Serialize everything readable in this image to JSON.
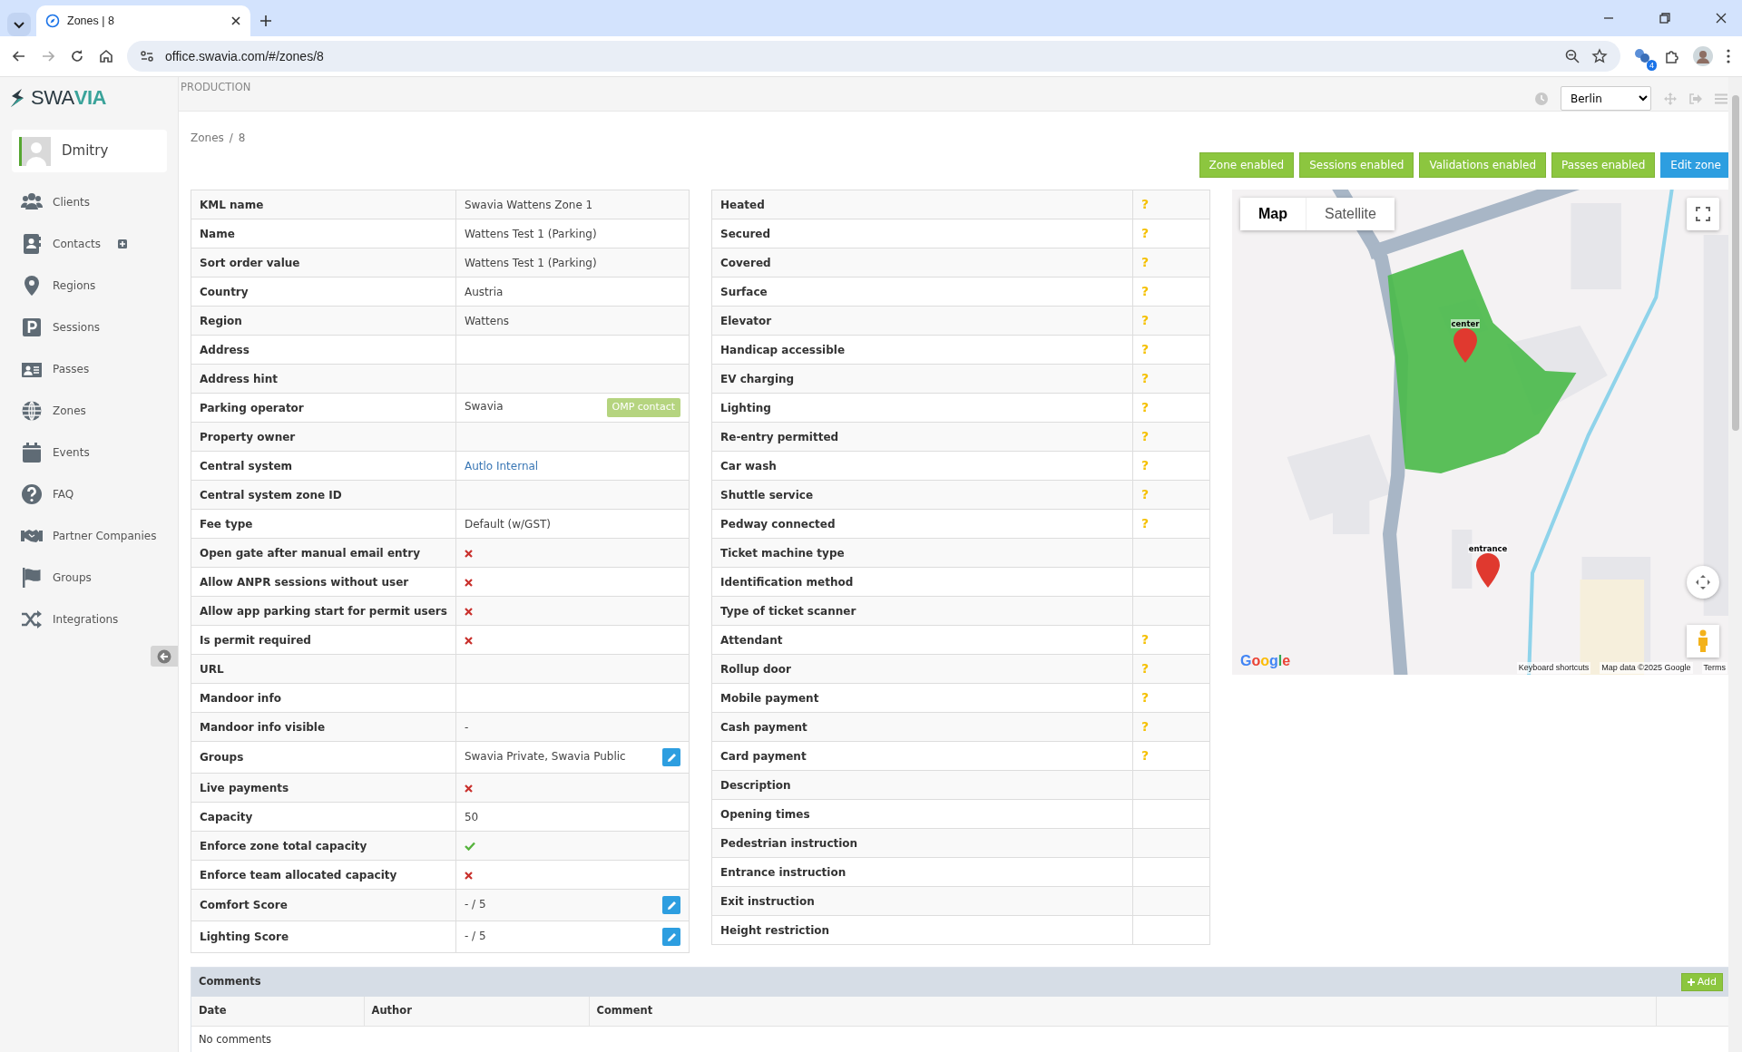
{
  "browser": {
    "tabs": [
      {
        "title": "Zones | 8",
        "selected": true
      }
    ],
    "url": "office.swavia.com/#/zones/8",
    "extension_badge": "4"
  },
  "app": {
    "logo": {
      "prefix": "SWA",
      "suffix": "VIA"
    },
    "environment": "PRODUCTION",
    "timezone": "Berlin"
  },
  "sidebar": {
    "user": "Dmitry",
    "items": [
      {
        "label": "Clients",
        "kind": "plain"
      },
      {
        "label": "Contacts",
        "kind": "with_add"
      },
      {
        "label": "Regions",
        "kind": "plain"
      },
      {
        "label": "Sessions",
        "kind": "plain"
      },
      {
        "label": "Passes",
        "kind": "plain"
      },
      {
        "label": "Zones",
        "kind": "plain"
      },
      {
        "label": "Events",
        "kind": "plain"
      },
      {
        "label": "FAQ",
        "kind": "plain"
      },
      {
        "label": "Partner Companies",
        "kind": "plain"
      },
      {
        "label": "Groups",
        "kind": "plain"
      },
      {
        "label": "Integrations",
        "kind": "plain"
      }
    ]
  },
  "breadcrumb": {
    "items": [
      "Zones",
      "8"
    ],
    "separator": "/"
  },
  "actions": [
    {
      "label": "Zone enabled",
      "kind": "status"
    },
    {
      "label": "Sessions enabled",
      "kind": "status"
    },
    {
      "label": "Validations enabled",
      "kind": "status"
    },
    {
      "label": "Passes enabled",
      "kind": "status"
    },
    {
      "label": "Edit zone",
      "kind": "edit"
    }
  ],
  "details": [
    {
      "label": "KML name",
      "kind": "text",
      "value": "Swavia Wattens Zone 1"
    },
    {
      "label": "Name",
      "kind": "text",
      "value": "Wattens Test 1 (Parking)"
    },
    {
      "label": "Sort order value",
      "kind": "text",
      "value": "Wattens Test 1 (Parking)"
    },
    {
      "label": "Country",
      "kind": "text",
      "value": "Austria"
    },
    {
      "label": "Region",
      "kind": "text",
      "value": "Wattens"
    },
    {
      "label": "Address",
      "kind": "text"
    },
    {
      "label": "Address hint",
      "kind": "text"
    },
    {
      "label": "Parking operator",
      "kind": "text_with_contact",
      "value": "Swavia",
      "contact_label": "OMP contact"
    },
    {
      "label": "Property owner",
      "kind": "text"
    },
    {
      "label": "Central system",
      "kind": "link",
      "value": "Autlo Internal"
    },
    {
      "label": "Central system zone ID",
      "kind": "text"
    },
    {
      "label": "Fee type",
      "kind": "text",
      "value": "Default (w/GST)"
    },
    {
      "label": "Open gate after manual email entry",
      "kind": "flag",
      "enabled": false
    },
    {
      "label": "Allow ANPR sessions without user",
      "kind": "flag",
      "enabled": false
    },
    {
      "label": "Allow app parking start for permit users",
      "kind": "flag",
      "enabled": false
    },
    {
      "label": "Is permit required",
      "kind": "flag",
      "enabled": false
    },
    {
      "label": "URL",
      "kind": "text"
    },
    {
      "label": "Mandoor info",
      "kind": "text"
    },
    {
      "label": "Mandoor info visible",
      "kind": "text",
      "value": "-"
    },
    {
      "label": "Groups",
      "kind": "text_edit",
      "value": "Swavia Private, Swavia Public"
    },
    {
      "label": "Live payments",
      "kind": "flag",
      "enabled": false
    },
    {
      "label": "Capacity",
      "kind": "text",
      "value": "50"
    },
    {
      "label": "Enforce zone total capacity",
      "kind": "flag",
      "enabled": true
    },
    {
      "label": "Enforce team allocated capacity",
      "kind": "flag",
      "enabled": false
    },
    {
      "label": "Comfort Score",
      "kind": "text_edit",
      "value": "- / 5"
    },
    {
      "label": "Lighting Score",
      "kind": "text_edit",
      "value": "- / 5"
    }
  ],
  "features": [
    {
      "label": "Heated",
      "value": "?"
    },
    {
      "label": "Secured",
      "value": "?"
    },
    {
      "label": "Covered",
      "value": "?"
    },
    {
      "label": "Surface",
      "value": "?"
    },
    {
      "label": "Elevator",
      "value": "?"
    },
    {
      "label": "Handicap accessible",
      "value": "?"
    },
    {
      "label": "EV charging",
      "value": "?"
    },
    {
      "label": "Lighting",
      "value": "?"
    },
    {
      "label": "Re-entry permitted",
      "value": "?"
    },
    {
      "label": "Car wash",
      "value": "?"
    },
    {
      "label": "Shuttle service",
      "value": "?"
    },
    {
      "label": "Pedway connected",
      "value": "?"
    },
    {
      "label": "Ticket machine type"
    },
    {
      "label": "Identification method"
    },
    {
      "label": "Type of ticket scanner"
    },
    {
      "label": "Attendant",
      "value": "?"
    },
    {
      "label": "Rollup door",
      "value": "?"
    },
    {
      "label": "Mobile payment",
      "value": "?"
    },
    {
      "label": "Cash payment",
      "value": "?"
    },
    {
      "label": "Card payment",
      "value": "?"
    },
    {
      "label": "Description"
    },
    {
      "label": "Opening times"
    },
    {
      "label": "Pedestrian instruction"
    },
    {
      "label": "Entrance instruction"
    },
    {
      "label": "Exit instruction"
    },
    {
      "label": "Height restriction"
    }
  ],
  "map": {
    "map_types": [
      {
        "label": "Map",
        "selected": true
      },
      {
        "label": "Satellite",
        "selected": false
      }
    ],
    "markers": [
      {
        "label": "center"
      },
      {
        "label": "entrance"
      }
    ],
    "logo": "Google",
    "attribution": [
      "Keyboard shortcuts",
      "Map data ©2025 Google",
      "Terms"
    ]
  },
  "comments": {
    "title": "Comments",
    "add_label": "Add",
    "columns": [
      "Date",
      "Author",
      "Comment"
    ],
    "empty_text": "No comments"
  }
}
